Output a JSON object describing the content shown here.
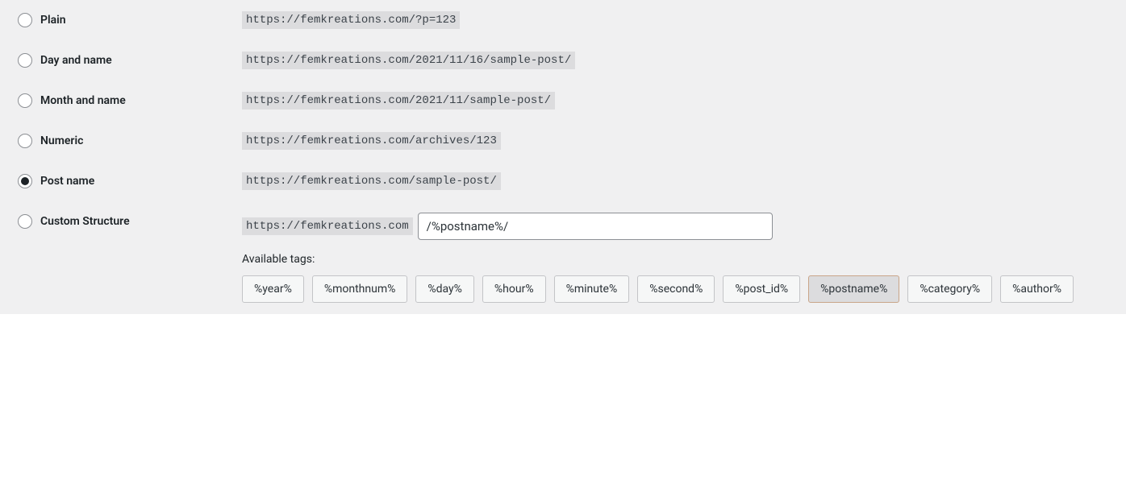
{
  "permalinks": {
    "selected_index": 4,
    "options": [
      {
        "label": "Plain",
        "example": "https://femkreations.com/?p=123"
      },
      {
        "label": "Day and name",
        "example": "https://femkreations.com/2021/11/16/sample-post/"
      },
      {
        "label": "Month and name",
        "example": "https://femkreations.com/2021/11/sample-post/"
      },
      {
        "label": "Numeric",
        "example": "https://femkreations.com/archives/123"
      },
      {
        "label": "Post name",
        "example": "https://femkreations.com/sample-post/"
      }
    ],
    "custom": {
      "label": "Custom Structure",
      "base_url": "https://femkreations.com",
      "value": "/%postname%/",
      "tags_label": "Available tags:",
      "active_tag_index": 7,
      "tags": [
        "%year%",
        "%monthnum%",
        "%day%",
        "%hour%",
        "%minute%",
        "%second%",
        "%post_id%",
        "%postname%",
        "%category%",
        "%author%"
      ]
    }
  }
}
